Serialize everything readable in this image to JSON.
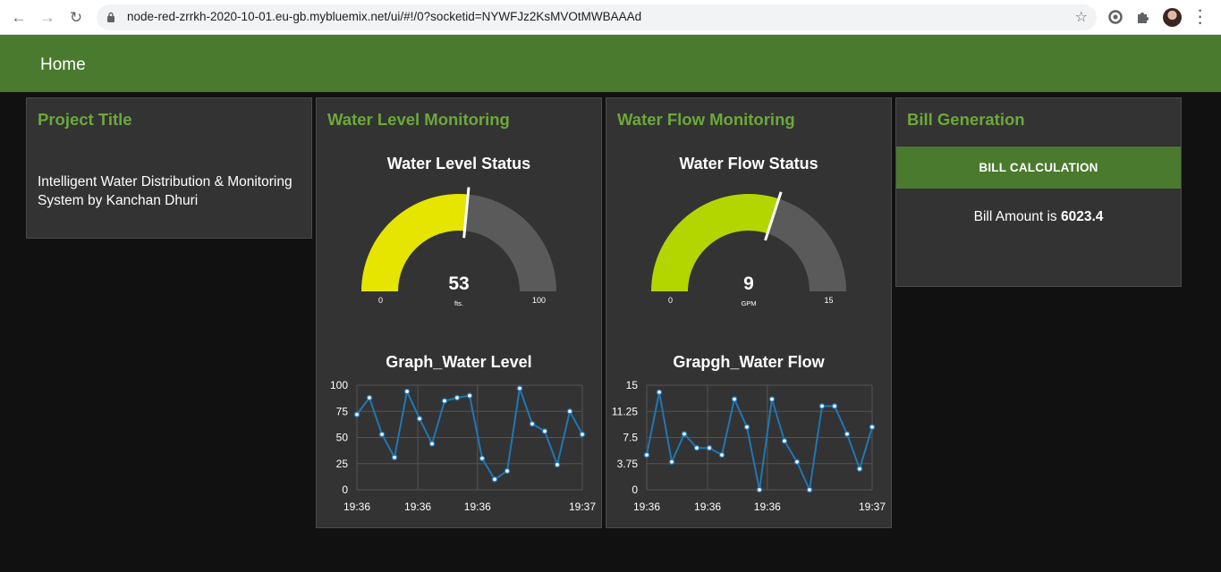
{
  "browser": {
    "url": "node-red-zrrkh-2020-10-01.eu-gb.mybluemix.net/ui/#!/0?socketid=NYWFJz2KsMVOtMWBAAAd"
  },
  "header": {
    "title": "Home"
  },
  "project_card": {
    "title": "Project Title",
    "text": "Intelligent Water Distribution & Monitoring System by Kanchan Dhuri"
  },
  "water_level_card": {
    "title": "Water Level Monitoring",
    "gauge": {
      "title": "Water Level Status",
      "value": 53,
      "value_label": "53",
      "min": 0,
      "max": 100,
      "min_label": "0",
      "max_label": "100",
      "units": "fts.",
      "fill_color": "#e5e500",
      "track_color": "#5a5a5a"
    },
    "chart_title": "Graph_Water Level"
  },
  "water_flow_card": {
    "title": "Water Flow Monitoring",
    "gauge": {
      "title": "Water Flow Status",
      "value": 9,
      "value_label": "9",
      "min": 0,
      "max": 15,
      "min_label": "0",
      "max_label": "15",
      "units": "GPM",
      "fill_color": "#b3d600",
      "track_color": "#5a5a5a"
    },
    "chart_title": "Grapgh_Water Flow"
  },
  "bill_card": {
    "title": "Bill Generation",
    "button_label": "BILL CALCULATION",
    "amount_prefix": "Bill Amount is ",
    "amount_value": "6023.4"
  },
  "chart_data": [
    {
      "type": "line",
      "title": "Graph_Water Level",
      "xlabel": "",
      "ylabel": "",
      "ylim": [
        0,
        100
      ],
      "y_ticks": [
        "0",
        "25",
        "50",
        "75",
        "100"
      ],
      "x_tick_labels": [
        "19:36",
        "19:36",
        "19:36",
        "19:37"
      ],
      "grid": true,
      "line_color": "#1f77b4",
      "series": [
        {
          "values": [
            72,
            88,
            53,
            31,
            94,
            68,
            44,
            85,
            88,
            90,
            30,
            10,
            18,
            97,
            63,
            56,
            24,
            75,
            53
          ]
        }
      ]
    },
    {
      "type": "line",
      "title": "Grapgh_Water Flow",
      "xlabel": "",
      "ylabel": "",
      "ylim": [
        0,
        15
      ],
      "y_ticks": [
        "0",
        "3.75",
        "7.5",
        "11.25",
        "15"
      ],
      "x_tick_labels": [
        "19:36",
        "19:36",
        "19:36",
        "19:37"
      ],
      "grid": true,
      "line_color": "#1f77b4",
      "series": [
        {
          "values": [
            5,
            14,
            4,
            8,
            6,
            6,
            5,
            13,
            9,
            0,
            13,
            7,
            4,
            0,
            12,
            12,
            8,
            3,
            9
          ]
        }
      ]
    }
  ]
}
